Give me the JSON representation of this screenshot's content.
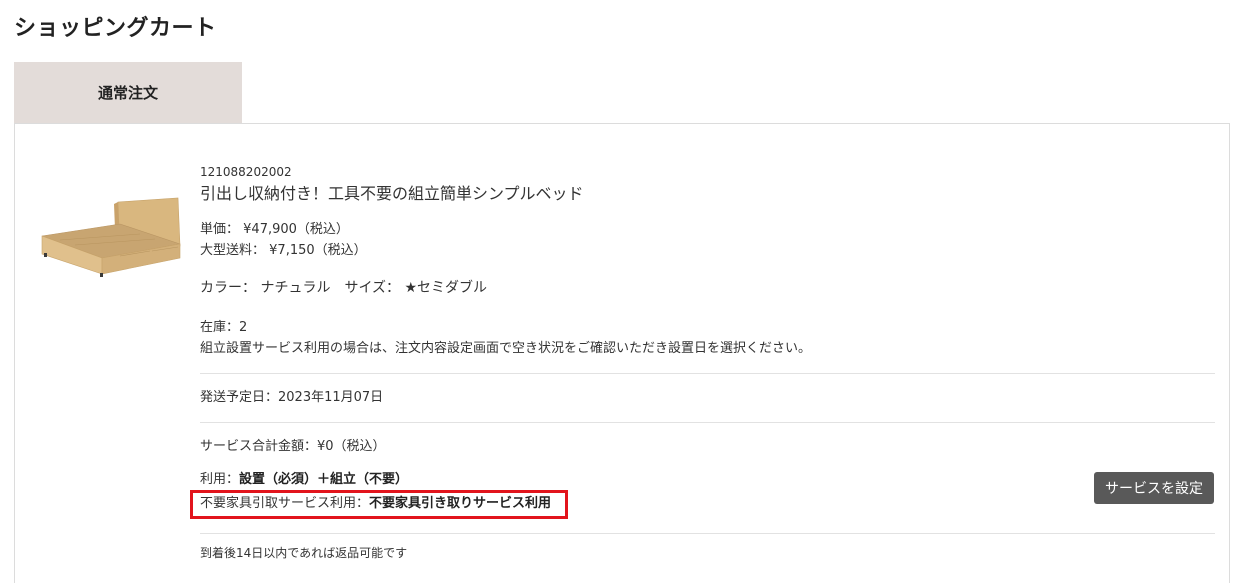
{
  "page": {
    "title": "ショッピングカート"
  },
  "tabs": [
    {
      "label": "通常注文"
    }
  ],
  "item": {
    "sku": "121088202002",
    "name": "引出し収納付き！工具不要の組立簡単シンプルベッド",
    "unit_price_label": "単価：",
    "unit_price": "¥47,900（税込）",
    "shipping_label": "大型送料：",
    "shipping": "¥7,150（税込）",
    "variant": "カラー： ナチュラル　サイズ： ★セミダブル",
    "stock_label": "在庫：2",
    "stock_note": "組立設置サービス利用の場合は、注文内容設定画面で空き状況をご確認いただき設置日を選択ください。",
    "ship_date": "発送予定日：2023年11月07日",
    "service_total": "サービス合計金額：¥0（税込）",
    "usage_label": "利用：",
    "usage_value": "設置（必須）＋組立（不要）",
    "disposal_label": "不要家具引取サービス利用：",
    "disposal_value": "不要家具引き取りサービス利用",
    "return_note": "到着後14日以内であれば返品可能です"
  },
  "buttons": {
    "service_settings": "サービスを設定"
  },
  "colors": {
    "tab_bg": "#e3dcd9",
    "highlight": "#e2141c",
    "button_bg": "#595959"
  }
}
